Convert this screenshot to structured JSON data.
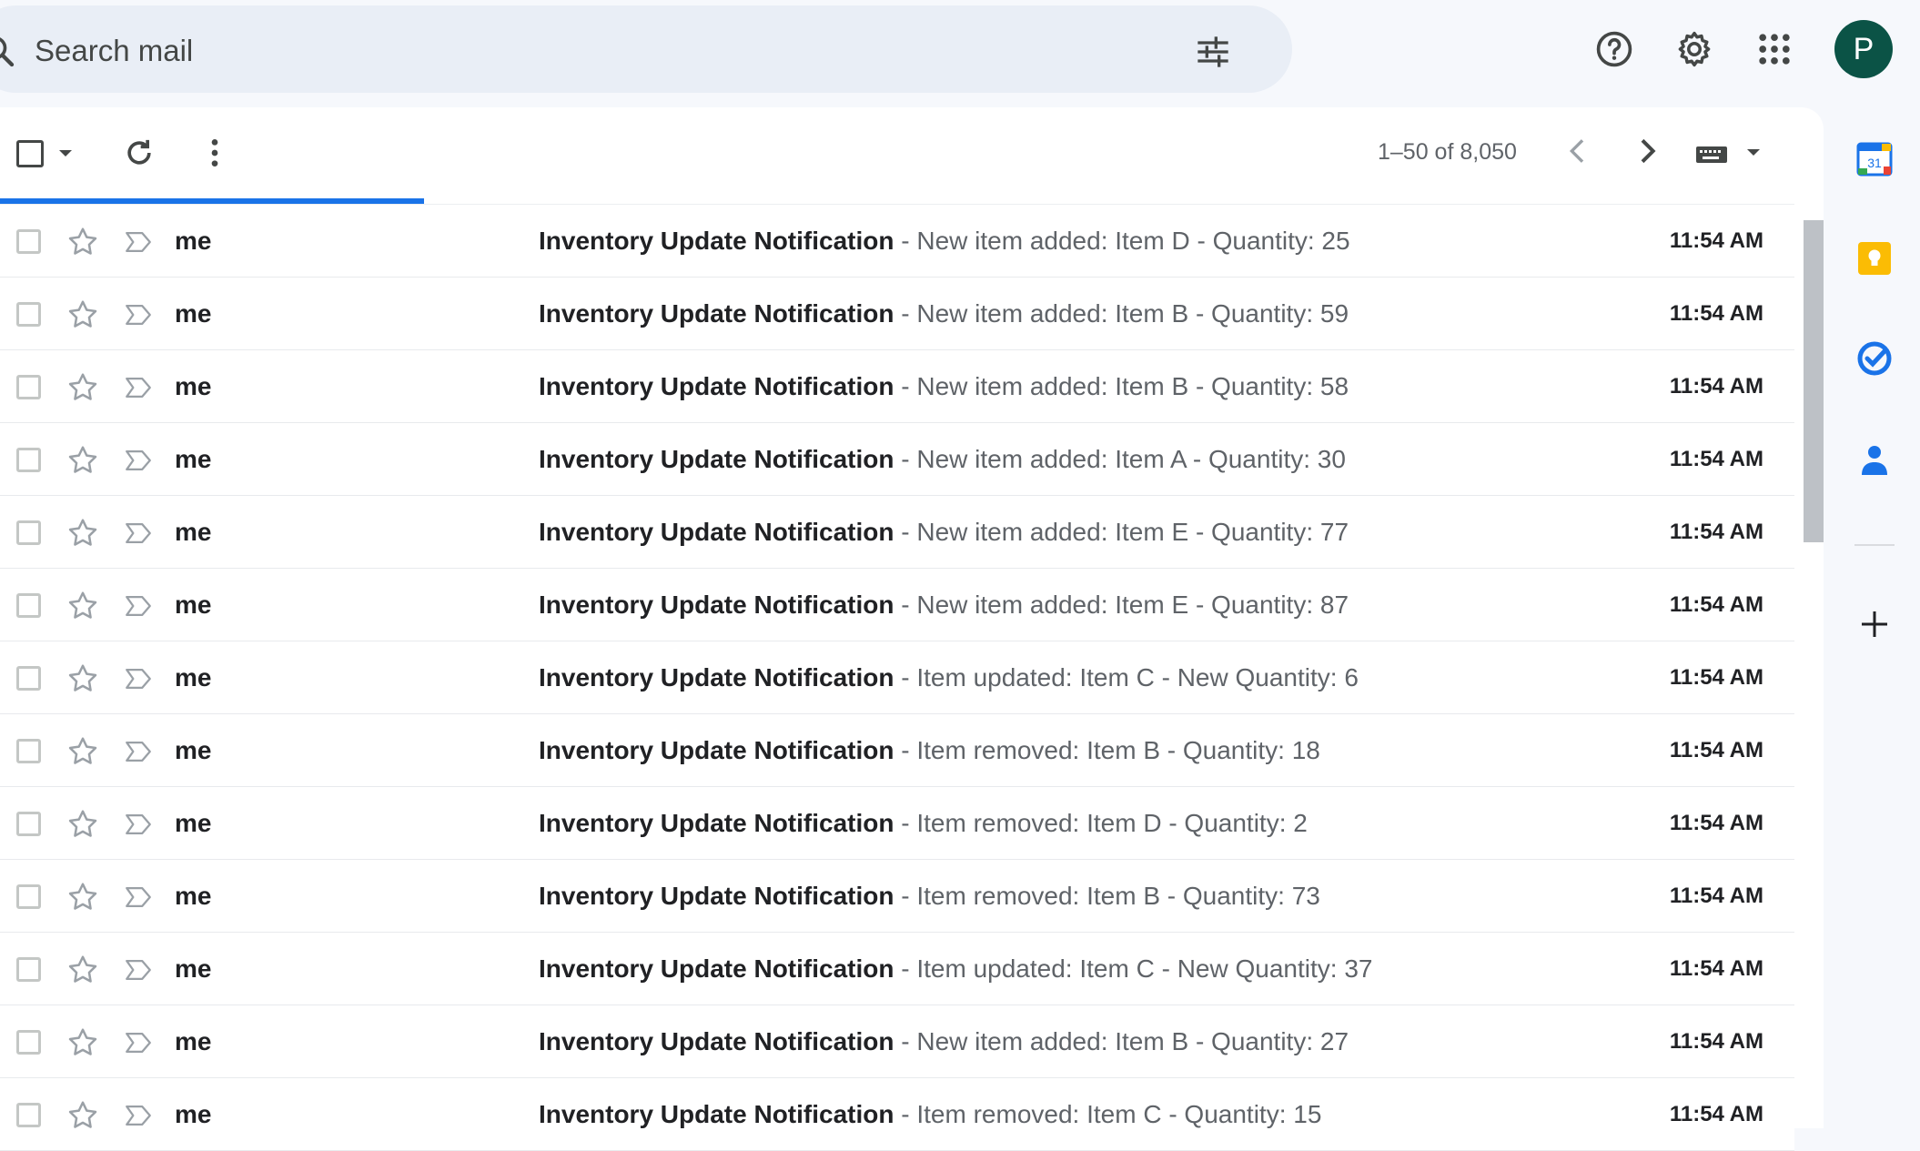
{
  "search": {
    "placeholder": "Search mail"
  },
  "header": {
    "avatar_letter": "P"
  },
  "toolbar": {
    "range": "1–50 of 8,050"
  },
  "emails": [
    {
      "sender": "me",
      "subject": "Inventory Update Notification",
      "sep": " - ",
      "preview": "New item added: Item D - Quantity: 25",
      "time": "11:54 AM"
    },
    {
      "sender": "me",
      "subject": "Inventory Update Notification",
      "sep": " - ",
      "preview": "New item added: Item B - Quantity: 59",
      "time": "11:54 AM"
    },
    {
      "sender": "me",
      "subject": "Inventory Update Notification",
      "sep": " - ",
      "preview": "New item added: Item B - Quantity: 58",
      "time": "11:54 AM"
    },
    {
      "sender": "me",
      "subject": "Inventory Update Notification",
      "sep": " - ",
      "preview": "New item added: Item A - Quantity: 30",
      "time": "11:54 AM"
    },
    {
      "sender": "me",
      "subject": "Inventory Update Notification",
      "sep": " - ",
      "preview": "New item added: Item E - Quantity: 77",
      "time": "11:54 AM"
    },
    {
      "sender": "me",
      "subject": "Inventory Update Notification",
      "sep": " - ",
      "preview": "New item added: Item E - Quantity: 87",
      "time": "11:54 AM"
    },
    {
      "sender": "me",
      "subject": "Inventory Update Notification",
      "sep": " - ",
      "preview": "Item updated: Item C - New Quantity: 6",
      "time": "11:54 AM"
    },
    {
      "sender": "me",
      "subject": "Inventory Update Notification",
      "sep": " - ",
      "preview": "Item removed: Item B - Quantity: 18",
      "time": "11:54 AM"
    },
    {
      "sender": "me",
      "subject": "Inventory Update Notification",
      "sep": " - ",
      "preview": "Item removed: Item D - Quantity: 2",
      "time": "11:54 AM"
    },
    {
      "sender": "me",
      "subject": "Inventory Update Notification",
      "sep": " - ",
      "preview": "Item removed: Item B - Quantity: 73",
      "time": "11:54 AM"
    },
    {
      "sender": "me",
      "subject": "Inventory Update Notification",
      "sep": " - ",
      "preview": "Item updated: Item C - New Quantity: 37",
      "time": "11:54 AM"
    },
    {
      "sender": "me",
      "subject": "Inventory Update Notification",
      "sep": " - ",
      "preview": "New item added: Item B - Quantity: 27",
      "time": "11:54 AM"
    },
    {
      "sender": "me",
      "subject": "Inventory Update Notification",
      "sep": " - ",
      "preview": "Item removed: Item C - Quantity: 15",
      "time": "11:54 AM"
    }
  ],
  "side_panel": {
    "calendar_day": "31",
    "items": [
      "calendar-icon",
      "keep-icon",
      "tasks-icon",
      "contacts-icon",
      "add-icon"
    ]
  },
  "colors": {
    "accent": "#1a73e8",
    "avatar": "#0b5346",
    "search_bg": "#e9eef6",
    "keep": "#fbbc04",
    "tasks": "#1a73e8",
    "contacts": "#1a73e8"
  },
  "icons": [
    "search-icon",
    "filter-icon",
    "help-icon",
    "settings-icon",
    "apps-icon",
    "refresh-icon",
    "more-icon",
    "chevron-left-icon",
    "chevron-right-icon",
    "keyboard-icon",
    "star-icon",
    "important-icon"
  ]
}
